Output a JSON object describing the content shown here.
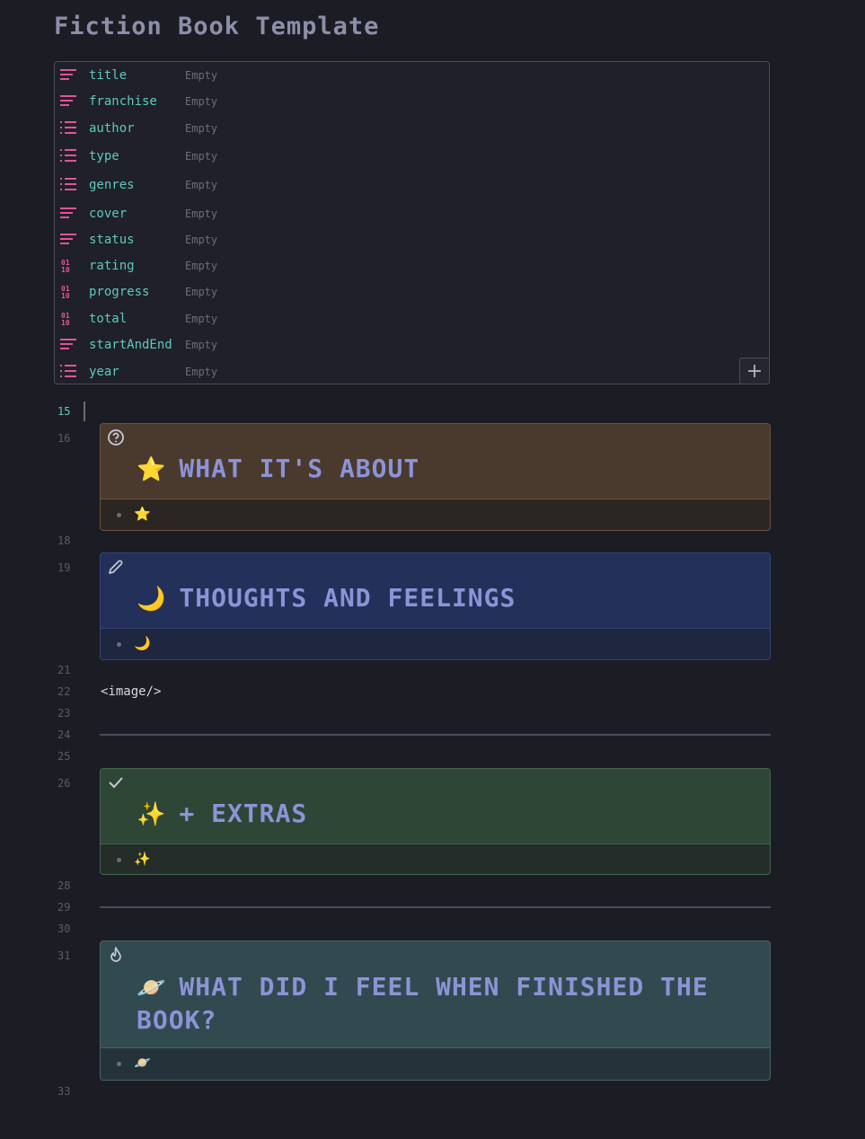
{
  "page": {
    "title": "Fiction Book Template"
  },
  "properties": [
    {
      "icon": "text-lines-icon",
      "key": "title",
      "value": "Empty"
    },
    {
      "icon": "text-lines-icon",
      "key": "franchise",
      "value": "Empty"
    },
    {
      "icon": "list-icon",
      "key": "author",
      "value": "Empty"
    },
    {
      "icon": "list-icon",
      "key": "type",
      "value": "Empty"
    },
    {
      "icon": "list-icon",
      "key": "genres",
      "value": "Empty"
    },
    {
      "icon": "text-lines-icon",
      "key": "cover",
      "value": "Empty"
    },
    {
      "icon": "text-lines-icon",
      "key": "status",
      "value": "Empty"
    },
    {
      "icon": "binary-number-icon",
      "key": "rating",
      "value": "Empty"
    },
    {
      "icon": "binary-number-icon",
      "key": "progress",
      "value": "Empty"
    },
    {
      "icon": "binary-number-icon",
      "key": "total",
      "value": "Empty"
    },
    {
      "icon": "text-lines-icon",
      "key": "startAndEnd",
      "value": "Empty"
    },
    {
      "icon": "list-icon",
      "key": "year",
      "value": "Empty"
    }
  ],
  "add_property_label": "+",
  "line_numbers": {
    "l15": "15",
    "l16": "16",
    "l18": "18",
    "l19": "19",
    "l21": "21",
    "l22": "22",
    "l23": "23",
    "l24": "24",
    "l25": "25",
    "l26": "26",
    "l28": "28",
    "l29": "29",
    "l30": "30",
    "l31": "31",
    "l33": "33"
  },
  "callouts": {
    "about": {
      "icon": "question-circle-icon",
      "emoji": "⭐",
      "title": "WHAT IT'S ABOUT",
      "bullet": "⭐",
      "color": "#4a3a2e"
    },
    "thoughts": {
      "icon": "pencil-icon",
      "emoji": "🌙",
      "title": "THOUGHTS AND FEELINGS",
      "bullet": "🌙",
      "color": "#22305a"
    },
    "extras": {
      "icon": "check-icon",
      "emoji": "✨",
      "title": "+ EXTRAS",
      "bullet": "✨",
      "color": "#2e4636"
    },
    "finished": {
      "icon": "flame-icon",
      "emoji": "🪐",
      "title": "WHAT DID I FEEL WHEN FINISHED THE BOOK?",
      "bullet": "🪐",
      "color": "#304a50"
    }
  },
  "code_line": "<image/>"
}
